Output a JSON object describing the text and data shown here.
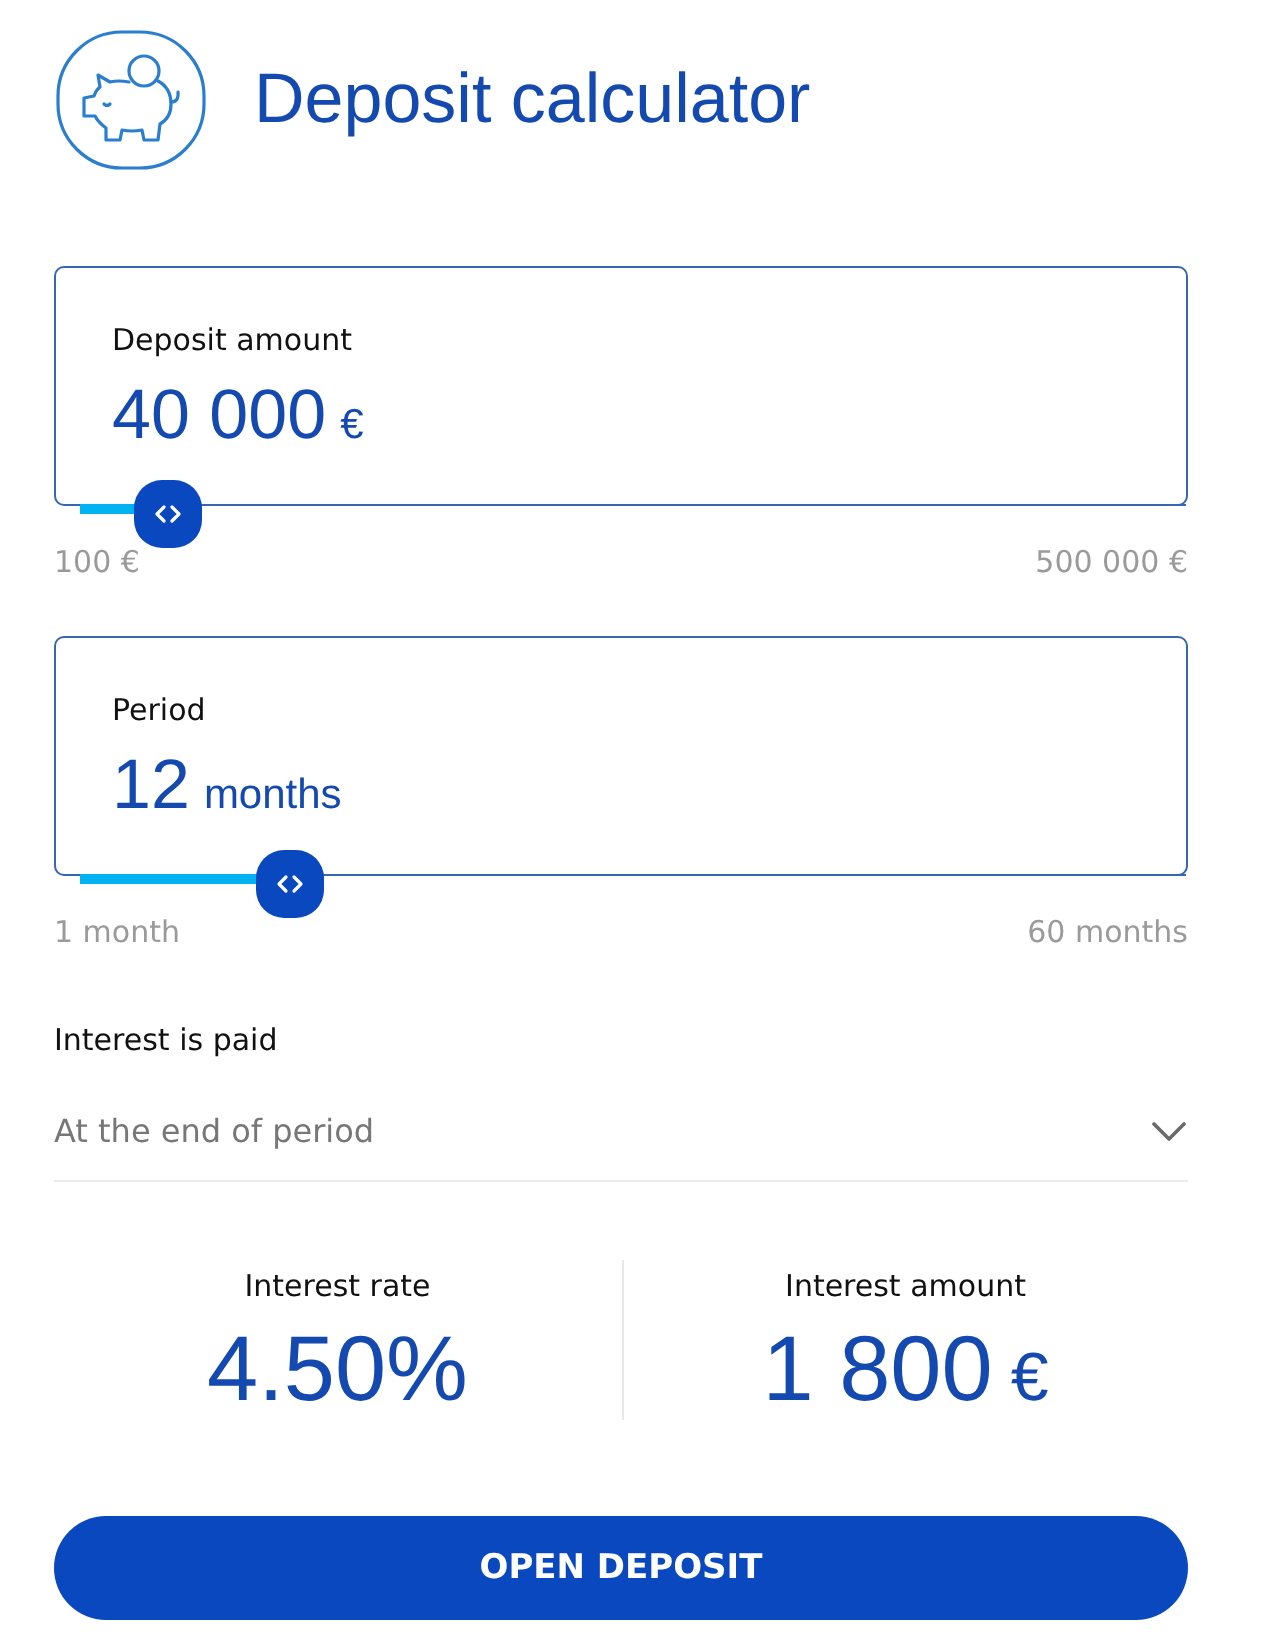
{
  "header": {
    "title": "Deposit calculator"
  },
  "sliders": [
    {
      "label": "Deposit amount",
      "value": "40 000",
      "unit": "€",
      "level": 0.08,
      "min_label": "100 €",
      "max_label": "500 000 €"
    },
    {
      "label": "Period",
      "value": "12",
      "unit": "months",
      "level": 0.19,
      "min_label": "1 month",
      "max_label": "60 months"
    }
  ],
  "interest_payment": {
    "label": "Interest is paid",
    "value": "At the end of period"
  },
  "results": [
    {
      "label": "Interest rate",
      "value": "4.50%"
    },
    {
      "label": "Interest amount",
      "value": "1 800",
      "unit": "€"
    }
  ],
  "button": {
    "label": "OPEN DEPOSIT"
  }
}
